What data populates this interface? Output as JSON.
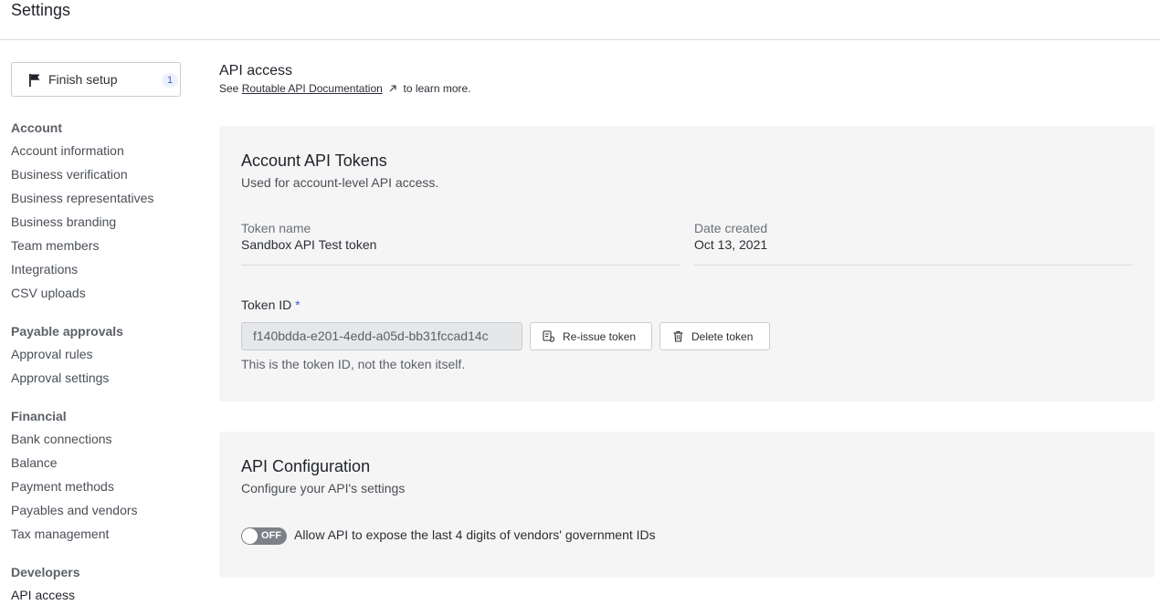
{
  "header": {
    "title": "Settings"
  },
  "finish_setup": {
    "label": "Finish setup",
    "count": "1"
  },
  "sidebar": {
    "account": {
      "title": "Account",
      "items": [
        "Account information",
        "Business verification",
        "Business representatives",
        "Business branding",
        "Team members",
        "Integrations",
        "CSV uploads"
      ]
    },
    "payable_approvals": {
      "title": "Payable approvals",
      "items": [
        "Approval rules",
        "Approval settings"
      ]
    },
    "financial": {
      "title": "Financial",
      "items": [
        "Bank connections",
        "Balance",
        "Payment methods",
        "Payables and vendors",
        "Tax management"
      ]
    },
    "developers": {
      "title": "Developers",
      "items": [
        "API access"
      ]
    },
    "active_item": "API access"
  },
  "main": {
    "title": "API access",
    "subtitle_prefix": "See",
    "doc_link": "Routable API Documentation",
    "subtitle_suffix": "to learn more."
  },
  "tokens_card": {
    "title": "Account API Tokens",
    "subtitle": "Used for account-level API access.",
    "token_name_label": "Token name",
    "token_name_value": "Sandbox API Test token",
    "date_created_label": "Date created",
    "date_created_value": "Oct 13, 2021",
    "token_id_label": "Token ID",
    "required_mark": "*",
    "token_id_value": "f140bdda-e201-4edd-a05d-bb31fccad14c",
    "reissue_label": "Re-issue token",
    "delete_label": "Delete token",
    "help_text": "This is the token ID, not the token itself."
  },
  "config_card": {
    "title": "API Configuration",
    "subtitle": "Configure your API's settings",
    "toggle_state": "OFF",
    "toggle_on": false,
    "toggle_label": "Allow API to expose the last 4 digits of vendors' government IDs"
  },
  "colors": {
    "accent": "#3b5bd8",
    "card_bg": "#f5f5f5",
    "toggle_off": "#7d8187"
  },
  "icons": {
    "finish_setup": "flag-icon",
    "doc_link": "external-link-icon",
    "reissue": "reissue-icon",
    "delete": "trash-icon"
  }
}
